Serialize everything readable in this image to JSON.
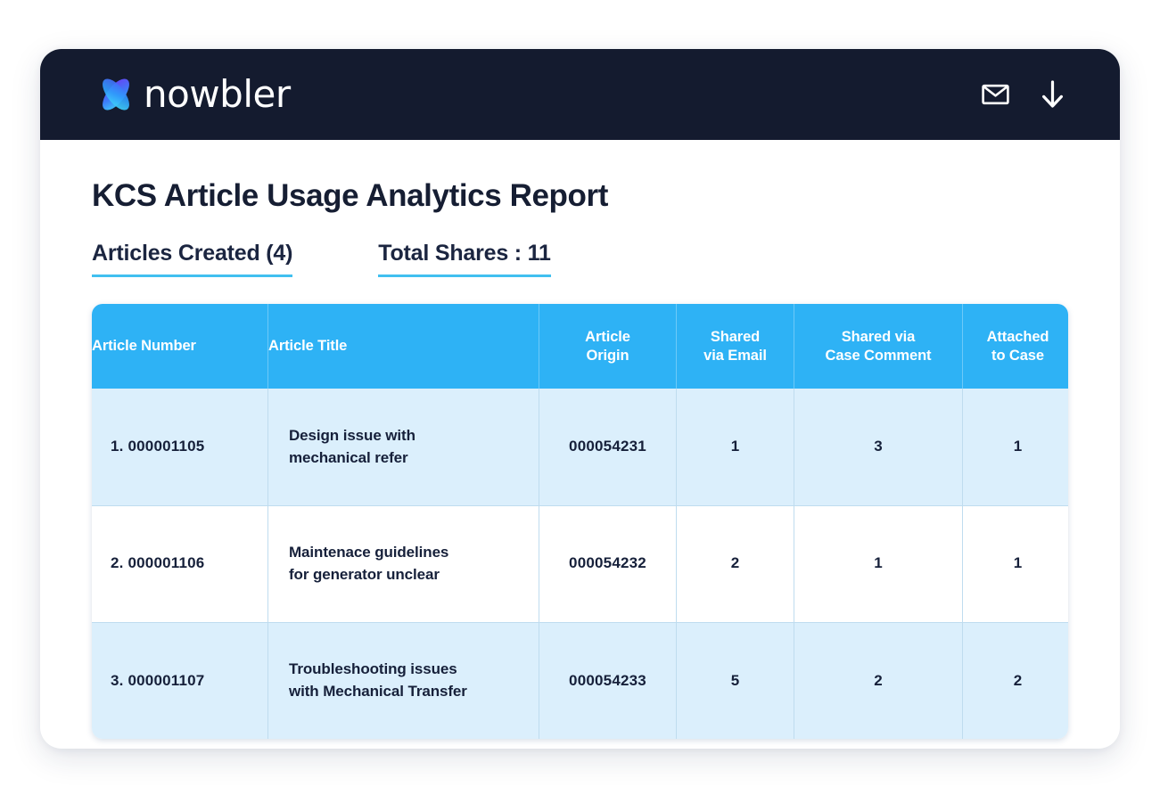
{
  "brand": {
    "word": "nowbler",
    "mark_icon": "knowbler-k-logo-icon",
    "gradient_from": "#6C3BF4",
    "gradient_to": "#3FD9F7"
  },
  "topbar": {
    "background": "#141B2F",
    "email_icon": "envelope-icon",
    "download_icon": "download-arrow-icon"
  },
  "header": {
    "title": "KCS Article Usage Analytics Report"
  },
  "stats": [
    {
      "label": "Articles Created (4)",
      "underline_color": "#41C0F0"
    },
    {
      "label": "Total Shares : 11",
      "underline_color": "#41C0F0"
    }
  ],
  "table": {
    "header_background": "#2EB2F5",
    "alt_row_background": "#DBEFFC",
    "columns": [
      {
        "key": "article_number",
        "label_line1": "Article Number",
        "label_line2": "",
        "align": "left"
      },
      {
        "key": "article_title",
        "label_line1": "Article Title",
        "label_line2": "",
        "align": "left"
      },
      {
        "key": "article_origin",
        "label_line1": "Article",
        "label_line2": "Origin",
        "align": "center"
      },
      {
        "key": "shared_via_email",
        "label_line1": "Shared",
        "label_line2": "via Email",
        "align": "center"
      },
      {
        "key": "shared_via_case_comment",
        "label_line1": "Shared via",
        "label_line2": "Case Comment",
        "align": "center"
      },
      {
        "key": "attached_to_case",
        "label_line1": "Attached",
        "label_line2": "to Case",
        "align": "center"
      }
    ],
    "rows": [
      {
        "article_number": "1.  000001105",
        "article_title_line1": "Design issue with",
        "article_title_line2": "mechanical refer",
        "article_origin": "000054231",
        "shared_via_email": "1",
        "shared_via_case_comment": "3",
        "attached_to_case": "1"
      },
      {
        "article_number": "2. 000001106",
        "article_title_line1": "Maintenace guidelines",
        "article_title_line2": "for generator unclear",
        "article_origin": "000054232",
        "shared_via_email": "2",
        "shared_via_case_comment": "1",
        "attached_to_case": "1"
      },
      {
        "article_number": "3. 000001107",
        "article_title_line1": "Troubleshooting issues",
        "article_title_line2": "with Mechanical Transfer",
        "article_origin": "000054233",
        "shared_via_email": "5",
        "shared_via_case_comment": "2",
        "attached_to_case": "2"
      }
    ]
  }
}
